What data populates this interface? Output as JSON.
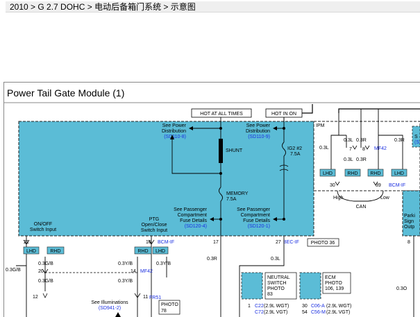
{
  "breadcrumb": "2010 > G 2.7 DOHC > 电动后备箱门系统 > 示意图",
  "title": "Power Tail Gate Module (1)",
  "hot_at_all_times": "HOT AT ALL TIMES",
  "hot_in_on": "HOT IN ON",
  "ipm": "IPM",
  "see_power_dist_1": {
    "l1": "See Power",
    "l2": "Distribution",
    "ref": "(SD110-8)"
  },
  "see_power_dist_2": {
    "l1": "See Power",
    "l2": "Distribution",
    "ref": "(SD110-9)"
  },
  "shunt": "SHUNT",
  "ig2": {
    "l1": "IG2 #2",
    "l2": "7.5A"
  },
  "memory": {
    "l1": "MEMORY",
    "l2": "7.5A"
  },
  "see_pass_1": {
    "l1": "See Passenger",
    "l2": "Compartment",
    "l3": "Fuse Details",
    "ref": "(SD120-4)"
  },
  "see_pass_2": {
    "l1": "See Passenger",
    "l2": "Compartment",
    "l3": "Fuse Details",
    "ref": "(SD120-1)"
  },
  "on_off": {
    "l1": "ON/OFF",
    "l2": "Switch Input"
  },
  "ptg": {
    "l1": "PTG",
    "l2": "Open/Close",
    "l3": "Switch Input"
  },
  "ipm_wires": {
    "w1": "0.3L",
    "w2": "0.3L",
    "w3": "0.3R",
    "w4": "0.3L",
    "w5": "0.3R",
    "w6": "0.3R",
    "p7": "7",
    "p8": "8",
    "mf42": "MF42",
    "lhd": "LHD",
    "rhd": "RHD",
    "rhd2": "RHD",
    "lhd2": "LHD",
    "p30": "30",
    "p39": "39",
    "bcm_if": "BCM-IF",
    "high": "High",
    "low": "Low",
    "can": "CAN"
  },
  "right_box": {
    "s": "S",
    "s2": "(S",
    "l1": "Parki",
    "l2": "Sign",
    "l3": "Outp",
    "p8": "8"
  },
  "pins": {
    "p21": "21",
    "p16": "16",
    "bcm_if": "BCM-IF",
    "p17": "17",
    "p27": "27",
    "bec_if": "BEC-IF",
    "photo36": "PHOTO 36"
  },
  "left_wires": {
    "lhd": "LHD",
    "rhd": "RHD",
    "w_03gb_a": "0.3G/B",
    "w_03gb_b": "0.3G/B",
    "w_03gb_c": "0.3G/B",
    "p20": "20",
    "p12": "12"
  },
  "mid_wires": {
    "rhd": "RHD",
    "lhd": "LHD",
    "w_03yb_a": "0.3Y/B",
    "w_03yb_b": "0.3Y/B",
    "w_03yb_c": "0.3Y/B",
    "p14": "14",
    "mf42": "MF42",
    "p11": "11",
    "fr51": "FR51",
    "photo78": {
      "l1": "PHOTO",
      "l2": "78"
    },
    "see_illum": {
      "l1": "See Illuminations",
      "ref": "(SD941-2)"
    }
  },
  "w_03r": "0.3R",
  "w_03l": "0.3L",
  "w_03o": "0.3O",
  "neutral_switch": {
    "l1": "NEUTRAL",
    "l2": "SWITCH",
    "l3": "PHOTO",
    "l4": "83"
  },
  "ecm": {
    "l1": "ECM",
    "l2": "PHOTO",
    "l3": "106, 139"
  },
  "conn1": {
    "pin": "1",
    "a": "C22",
    "a_rest": "(2.9L WGT)",
    "b": "C72",
    "b_rest": "(2.9L VGT)"
  },
  "conn2": {
    "pin_a": "30",
    "pin_b": "54",
    "a": "C06-A",
    "a_rest": "(2.9L WGT)",
    "b": "C56-M",
    "b_rest": "(2.9L VGT)"
  }
}
